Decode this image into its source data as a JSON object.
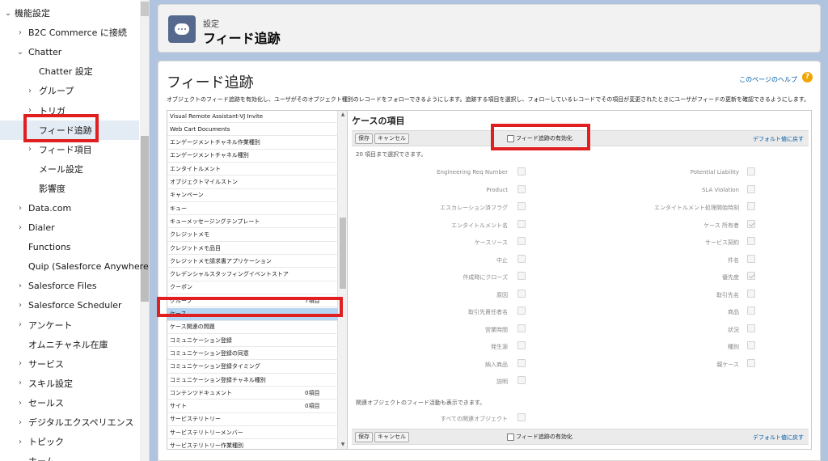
{
  "sidebar": {
    "items": [
      {
        "label": "機能設定",
        "chevron": "open",
        "indent": 0
      },
      {
        "label": "B2C Commerce に接続",
        "chevron": "closed",
        "indent": 1
      },
      {
        "label": "Chatter",
        "chevron": "open",
        "indent": 1
      },
      {
        "label": "Chatter 設定",
        "chevron": "none",
        "indent": 2
      },
      {
        "label": "グループ",
        "chevron": "closed",
        "indent": 2
      },
      {
        "label": "トリガ",
        "chevron": "closed",
        "indent": 2
      },
      {
        "label": "フィード追跡",
        "chevron": "none",
        "indent": 2,
        "selected": true
      },
      {
        "label": "フィード項目",
        "chevron": "closed",
        "indent": 2
      },
      {
        "label": "メール設定",
        "chevron": "none",
        "indent": 2
      },
      {
        "label": "影響度",
        "chevron": "none",
        "indent": 2
      },
      {
        "label": "Data.com",
        "chevron": "closed",
        "indent": 1
      },
      {
        "label": "Dialer",
        "chevron": "closed",
        "indent": 1
      },
      {
        "label": "Functions",
        "chevron": "none",
        "indent": 1
      },
      {
        "label": "Quip (Salesforce Anywhere)",
        "chevron": "none",
        "indent": 1
      },
      {
        "label": "Salesforce Files",
        "chevron": "closed",
        "indent": 1
      },
      {
        "label": "Salesforce Scheduler",
        "chevron": "closed",
        "indent": 1
      },
      {
        "label": "アンケート",
        "chevron": "closed",
        "indent": 1
      },
      {
        "label": "オムニチャネル在庫",
        "chevron": "none",
        "indent": 1
      },
      {
        "label": "サービス",
        "chevron": "closed",
        "indent": 1
      },
      {
        "label": "スキル設定",
        "chevron": "closed",
        "indent": 1
      },
      {
        "label": "セールス",
        "chevron": "closed",
        "indent": 1
      },
      {
        "label": "デジタルエクスペリエンス",
        "chevron": "closed",
        "indent": 1
      },
      {
        "label": "トピック",
        "chevron": "closed",
        "indent": 1
      },
      {
        "label": "ホーム",
        "chevron": "none",
        "indent": 1
      }
    ]
  },
  "header": {
    "crumb": "設定",
    "title": "フィード追跡",
    "icon": "chat-bubble-icon"
  },
  "main": {
    "heading": "フィード追跡",
    "help_link": "このページのヘルプ",
    "help_icon": "?",
    "description": "オブジェクトのフィード追跡を有効化し、ユーザがそのオブジェクト種別のレコードをフォローできるようにします。追跡する項目を選択し、フォローしているレコードでその項目が変更されたときにユーザがフィードの更新を確認できるようにします。"
  },
  "objects": [
    {
      "name": "Visual Remote Assistant-VJ Invite",
      "count": ""
    },
    {
      "name": "Web Cart Documents",
      "count": ""
    },
    {
      "name": "エンゲージメントチャネル作業種別",
      "count": ""
    },
    {
      "name": "エンゲージメントチャネル種別",
      "count": ""
    },
    {
      "name": "エンタイトルメント",
      "count": ""
    },
    {
      "name": "オブジェクトマイルストン",
      "count": ""
    },
    {
      "name": "キャンペーン",
      "count": ""
    },
    {
      "name": "キュー",
      "count": ""
    },
    {
      "name": "キューメッセージングテンプレート",
      "count": ""
    },
    {
      "name": "クレジットメモ",
      "count": ""
    },
    {
      "name": "クレジットメモ品目",
      "count": ""
    },
    {
      "name": "クレジットメモ請求書アプリケーション",
      "count": ""
    },
    {
      "name": "クレデンシャルスタッフィングイベントストア",
      "count": ""
    },
    {
      "name": "クーポン",
      "count": ""
    },
    {
      "name": "グループ",
      "count": "7項目"
    },
    {
      "name": "ケース",
      "count": "",
      "selected": true
    },
    {
      "name": "ケース関連の問題",
      "count": ""
    },
    {
      "name": "コミュニケーション登録",
      "count": ""
    },
    {
      "name": "コミュニケーション登録の同意",
      "count": ""
    },
    {
      "name": "コミュニケーション登録タイミング",
      "count": ""
    },
    {
      "name": "コミュニケーション登録チャネル種別",
      "count": ""
    },
    {
      "name": "コンテンツドキュメント",
      "count": "0項目"
    },
    {
      "name": "サイト",
      "count": "0項目"
    },
    {
      "name": "サービステリトリー",
      "count": ""
    },
    {
      "name": "サービステリトリーメンバー",
      "count": ""
    },
    {
      "name": "サービステリトリー作業種別",
      "count": ""
    }
  ],
  "panel": {
    "title": "ケースの項目",
    "save_label": "保存",
    "cancel_label": "キャンセル",
    "enable_label": "フィード追跡の有効化",
    "default_link": "デフォルト値に戻す",
    "limit_hint": "20 項目まで選択できます。",
    "related_hint": "関連オブジェクトのフィード活動も表示できます。",
    "all_related_label": "すべての関連オブジェクト",
    "left_fields": [
      {
        "label": "Engineering Req Number",
        "checked": false
      },
      {
        "label": "Product",
        "checked": false
      },
      {
        "label": "エスカレーション済フラグ",
        "checked": false
      },
      {
        "label": "エンタイトルメント名",
        "checked": false
      },
      {
        "label": "ケースソース",
        "checked": false
      },
      {
        "label": "中止",
        "checked": false
      },
      {
        "label": "作成時にクローズ",
        "checked": false
      },
      {
        "label": "原因",
        "checked": false
      },
      {
        "label": "取引先責任者名",
        "checked": false
      },
      {
        "label": "営業時間",
        "checked": false
      },
      {
        "label": "発生源",
        "checked": false
      },
      {
        "label": "納入商品",
        "checked": false
      },
      {
        "label": "説明",
        "checked": false
      }
    ],
    "right_fields": [
      {
        "label": "Potential Liability",
        "checked": false
      },
      {
        "label": "SLA Violation",
        "checked": false
      },
      {
        "label": "エンタイトルメント処理開始時刻",
        "checked": false
      },
      {
        "label": "ケース 所有者",
        "checked": true
      },
      {
        "label": "サービス契約",
        "checked": false
      },
      {
        "label": "件名",
        "checked": false
      },
      {
        "label": "優先度",
        "checked": true
      },
      {
        "label": "取引先名",
        "checked": false
      },
      {
        "label": "商品",
        "checked": false
      },
      {
        "label": "状況",
        "checked": false
      },
      {
        "label": "種別",
        "checked": false
      },
      {
        "label": "親ケース",
        "checked": false
      }
    ]
  },
  "colors": {
    "highlight": "#e02020",
    "link": "#015ba7",
    "selected_row": "#b6d5f2",
    "icon_bg": "#54698d"
  }
}
